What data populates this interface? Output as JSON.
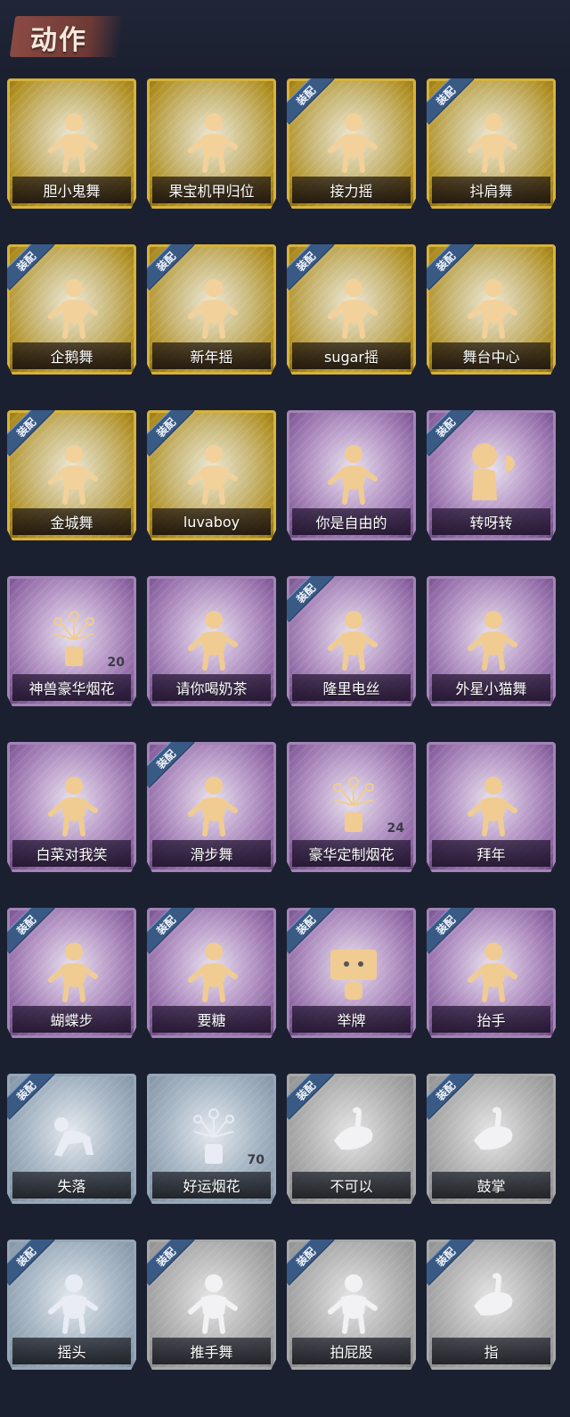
{
  "header": {
    "title": "动作"
  },
  "items": [
    {
      "label": "胆小鬼舞",
      "equipped": false,
      "count": "",
      "icon": "dance-pose-icon",
      "rarity": "gold"
    },
    {
      "label": "果宝机甲归位",
      "equipped": false,
      "count": "",
      "icon": "dance-pose-icon",
      "rarity": "gold"
    },
    {
      "label": "接力摇",
      "equipped": true,
      "count": "",
      "icon": "dance-pose-icon",
      "rarity": "gold"
    },
    {
      "label": "抖肩舞",
      "equipped": true,
      "count": "",
      "icon": "dance-pose-icon",
      "rarity": "gold"
    },
    {
      "label": "企鹅舞",
      "equipped": true,
      "count": "",
      "icon": "dance-pose-icon",
      "rarity": "gold"
    },
    {
      "label": "新年摇",
      "equipped": true,
      "count": "",
      "icon": "dance-pose-icon",
      "rarity": "gold"
    },
    {
      "label": "sugar摇",
      "equipped": true,
      "count": "",
      "icon": "dance-pose-icon",
      "rarity": "gold"
    },
    {
      "label": "舞台中心",
      "equipped": true,
      "count": "",
      "icon": "dance-pose-icon",
      "rarity": "gold"
    },
    {
      "label": "金城舞",
      "equipped": true,
      "count": "",
      "icon": "dance-pose-icon",
      "rarity": "gold"
    },
    {
      "label": "luvaboy",
      "equipped": true,
      "count": "",
      "icon": "dance-pose-icon",
      "rarity": "gold"
    },
    {
      "label": "你是自由的",
      "equipped": false,
      "count": "",
      "icon": "dance-pose-icon",
      "rarity": "purple"
    },
    {
      "label": "转呀转",
      "equipped": true,
      "count": "",
      "icon": "character-pose-icon",
      "rarity": "purple"
    },
    {
      "label": "神兽豪华烟花",
      "equipped": false,
      "count": "20",
      "icon": "fireworks-icon",
      "rarity": "purple"
    },
    {
      "label": "请你喝奶茶",
      "equipped": false,
      "count": "",
      "icon": "dance-pose-icon",
      "rarity": "purple"
    },
    {
      "label": "隆里电丝",
      "equipped": true,
      "count": "",
      "icon": "dance-pose-icon",
      "rarity": "purple"
    },
    {
      "label": "外星小猫舞",
      "equipped": false,
      "count": "",
      "icon": "dance-pose-icon",
      "rarity": "purple"
    },
    {
      "label": "白菜对我笑",
      "equipped": false,
      "count": "",
      "icon": "dance-pose-icon",
      "rarity": "purple"
    },
    {
      "label": "滑步舞",
      "equipped": true,
      "count": "",
      "icon": "dance-pose-icon",
      "rarity": "purple"
    },
    {
      "label": "豪华定制烟花",
      "equipped": false,
      "count": "24",
      "icon": "fireworks-icon",
      "rarity": "purple"
    },
    {
      "label": "拜年",
      "equipped": false,
      "count": "",
      "icon": "dance-pose-icon",
      "rarity": "purple"
    },
    {
      "label": "蝴蝶步",
      "equipped": true,
      "count": "",
      "icon": "dance-pose-icon",
      "rarity": "purple"
    },
    {
      "label": "要糖",
      "equipped": true,
      "count": "",
      "icon": "dance-pose-icon",
      "rarity": "purple"
    },
    {
      "label": "举牌",
      "equipped": true,
      "count": "",
      "icon": "sign-icon",
      "rarity": "purple"
    },
    {
      "label": "抬手",
      "equipped": true,
      "count": "",
      "icon": "dance-pose-icon",
      "rarity": "purple"
    },
    {
      "label": "失落",
      "equipped": true,
      "count": "",
      "icon": "kneel-pose-icon",
      "rarity": "blue"
    },
    {
      "label": "好运烟花",
      "equipped": false,
      "count": "70",
      "icon": "fireworks-icon",
      "rarity": "blue"
    },
    {
      "label": "不可以",
      "equipped": true,
      "count": "",
      "icon": "finger-wag-icon",
      "rarity": "grey"
    },
    {
      "label": "鼓掌",
      "equipped": true,
      "count": "",
      "icon": "clap-hands-icon",
      "rarity": "grey"
    },
    {
      "label": "摇头",
      "equipped": true,
      "count": "",
      "icon": "dance-pose-icon",
      "rarity": "blue"
    },
    {
      "label": "推手舞",
      "equipped": true,
      "count": "",
      "icon": "dance-pose-icon",
      "rarity": "grey"
    },
    {
      "label": "拍屁股",
      "equipped": true,
      "count": "",
      "icon": "dance-pose-icon",
      "rarity": "grey"
    },
    {
      "label": "指",
      "equipped": true,
      "count": "",
      "icon": "point-hand-icon",
      "rarity": "grey"
    }
  ],
  "badge_text": "装配"
}
